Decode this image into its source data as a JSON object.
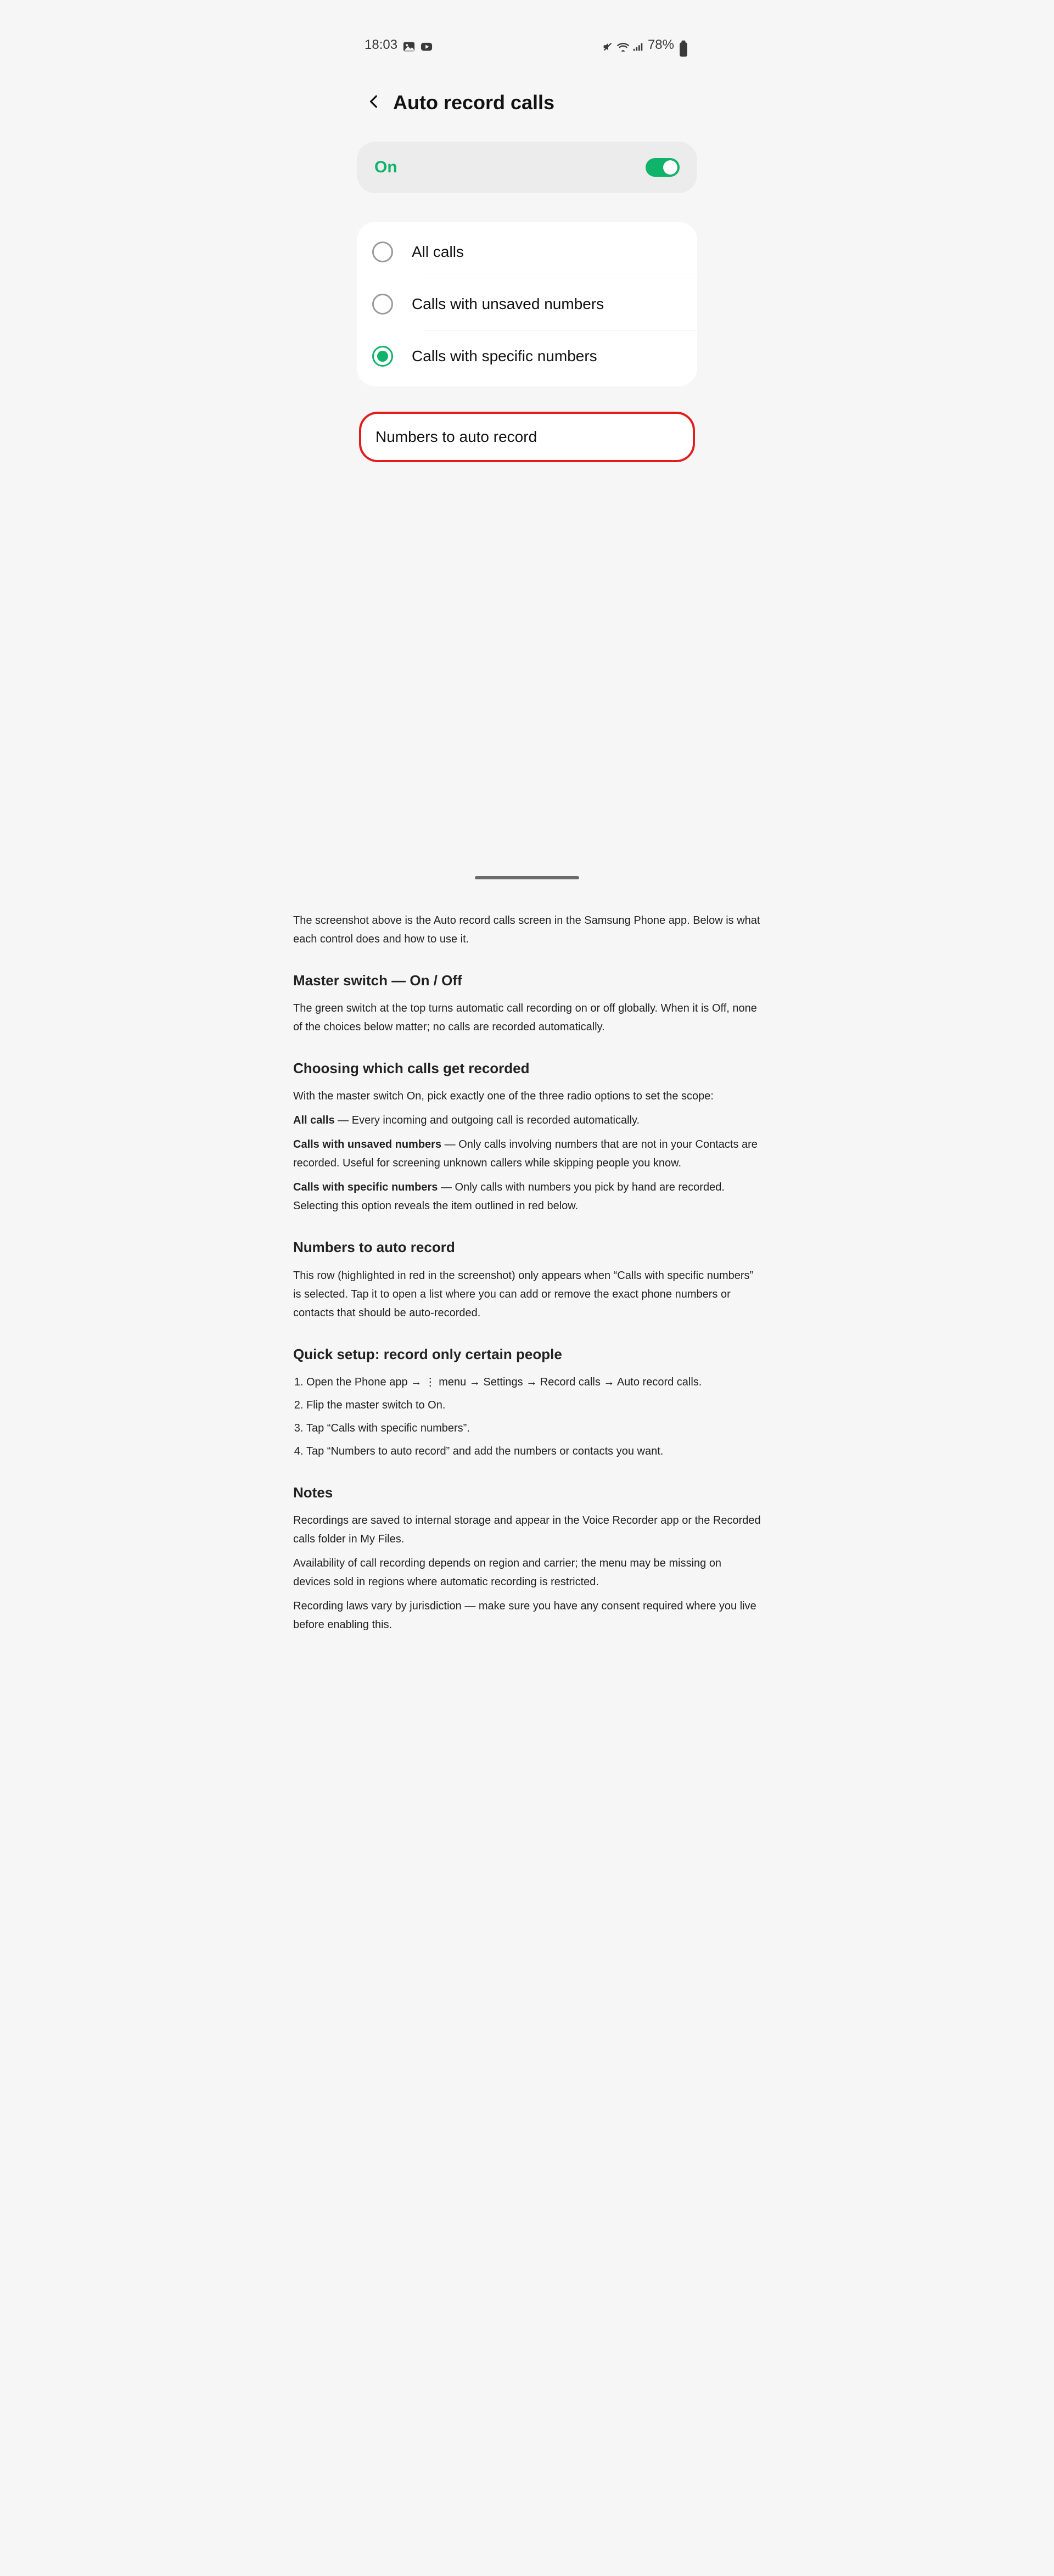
{
  "statusbar": {
    "time": "18:03",
    "battery_label": "78%"
  },
  "header": {
    "title": "Auto record calls"
  },
  "master_toggle": {
    "label": "On",
    "state": "on"
  },
  "options": [
    {
      "label": "All calls",
      "selected": false
    },
    {
      "label": "Calls with unsaved numbers",
      "selected": false
    },
    {
      "label": "Calls with specific numbers",
      "selected": true
    }
  ],
  "link_card": {
    "label": "Numbers to auto record"
  },
  "article": {
    "intro": "The screenshot above is the Auto record calls screen in the Samsung Phone app. Below is what each control does and how to use it.",
    "h_toggle": "Master switch — On / Off",
    "p_toggle": "The green switch at the top turns automatic call recording on or off globally. When it is Off, none of the choices below matter; no calls are recorded automatically.",
    "h_scope": "Choosing which calls get recorded",
    "p_scope": "With the master switch On, pick exactly one of the three radio options to set the scope:",
    "opt1_title": "All calls",
    "opt1_text": "Every incoming and outgoing call is recorded automatically.",
    "opt2_title": "Calls with unsaved numbers",
    "opt2_text": "Only calls involving numbers that are not in your Contacts are recorded. Useful for screening unknown callers while skipping people you know.",
    "opt3_title": "Calls with specific numbers",
    "opt3_text": "Only calls with numbers you pick by hand are recorded. Selecting this option reveals the item outlined in red below.",
    "h_link": "Numbers to auto record",
    "p_link": "This row (highlighted in red in the screenshot) only appears when “Calls with specific numbers” is selected. Tap it to open a list where you can add or remove the exact phone numbers or contacts that should be auto-recorded.",
    "h_steps": "Quick setup: record only certain people",
    "step1": "Open the Phone app → ⋮ menu → Settings → Record calls → Auto record calls.",
    "step2": "Flip the master switch to On.",
    "step3": "Tap “Calls with specific numbers”.",
    "step4": "Tap “Numbers to auto record” and add the numbers or contacts you want.",
    "h_notes": "Notes",
    "note1": "Recordings are saved to internal storage and appear in the Voice Recorder app or the Recorded calls folder in My Files.",
    "note2": "Availability of call recording depends on region and carrier; the menu may be missing on devices sold in regions where automatic recording is restricted.",
    "note3": "Recording laws vary by jurisdiction — make sure you have any consent required where you live before enabling this."
  }
}
